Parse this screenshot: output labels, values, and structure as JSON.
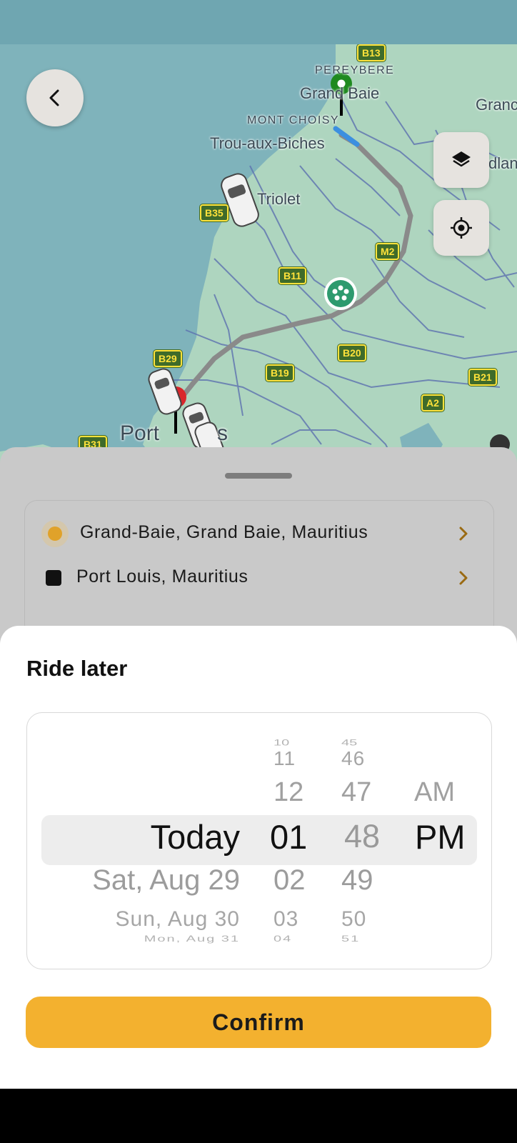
{
  "map": {
    "labels": {
      "pereybere": "PEREYBERE",
      "grand_baie": "Grand Baie",
      "grand_edge": "Granc",
      "mont_choisy": "MONT CHOISY",
      "trou_aux_biches": "Trou-aux-Biches",
      "triolet": "Triolet",
      "dlan": "dlan",
      "port": "Port",
      "port_suffix": "s"
    },
    "shields": {
      "b13": "B13",
      "b35": "B35",
      "b11": "B11",
      "m2": "M2",
      "b20": "B20",
      "b19": "B19",
      "b29": "B29",
      "a2": "A2",
      "b21": "B21",
      "b31": "B31"
    },
    "colors": {
      "water": "#7fb3bb",
      "land": "#aed5bf",
      "route": "#8a8a8a",
      "origin_pin": "#1f8a1f",
      "destination_pin": "#d9262b"
    }
  },
  "buttons": {
    "back_icon": "chevron-left-icon",
    "layers_icon": "layers-icon",
    "locate_icon": "crosshair-icon"
  },
  "route": {
    "origin": "Grand-Baie, Grand Baie, Mauritius",
    "destination": "Port Louis, Mauritius",
    "origin_dot_color": "#e0a22a",
    "chevron_color": "#9a6a12"
  },
  "ride_later": {
    "title": "Ride later",
    "picker": {
      "day": {
        "above": [],
        "selected": "Today",
        "below": [
          "Sat, Aug 29",
          "Sun, Aug 30",
          "Mon, Aug 31"
        ]
      },
      "hour": {
        "above": [
          "10",
          "11",
          "12"
        ],
        "selected": "01",
        "below": [
          "02",
          "03",
          "04"
        ]
      },
      "minute": {
        "above": [
          "45",
          "46",
          "47"
        ],
        "selected": "48",
        "below": [
          "49",
          "50",
          "51"
        ]
      },
      "ampm": {
        "above": [
          "AM"
        ],
        "selected": "PM",
        "below": []
      }
    },
    "confirm_label": "Confirm",
    "accent": "#f3b12f"
  }
}
